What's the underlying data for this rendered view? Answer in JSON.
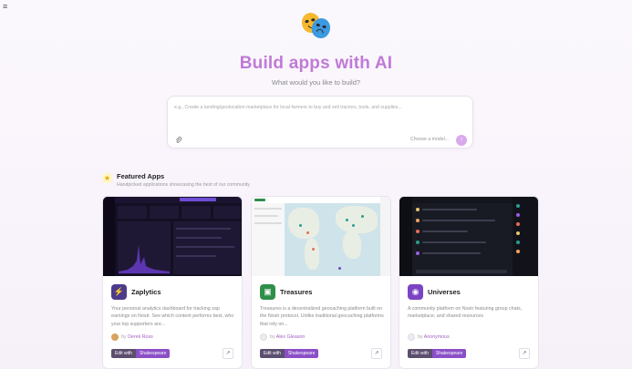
{
  "hero": {
    "title": "Build apps with AI",
    "subtitle": "What would you like to build?"
  },
  "prompt": {
    "placeholder": "e.g., Create a landing/geolocation marketplace for local farmers to buy and sell tractors, tools, and supplies...",
    "model_label": "Choose a model...",
    "attach_icon": "paperclip-icon",
    "send_icon": "arrow-up-icon"
  },
  "featured": {
    "title": "Featured Apps",
    "subtitle": "Handpicked applications showcasing the best of our community",
    "icon": "star-icon"
  },
  "apps": [
    {
      "name": "Zaplytics",
      "icon": "bolt-icon",
      "icon_color": "#4c3b8c",
      "description": "Your personal analytics dashboard for tracking zap earnings on Nostr. See which content performs best, who your top supporters are...",
      "by": "by",
      "author": "Derek Ross",
      "edit_label": "Edit with",
      "edit_tool": "Shakespeare"
    },
    {
      "name": "Treasures",
      "icon": "treasure-chest-icon",
      "icon_color": "#2f8f4a",
      "description": "Treasures is a decentralized geocaching platform built on the Nostr protocol. Unlike traditional geocaching platforms that rely on...",
      "by": "by",
      "author": "Alex Gleason",
      "edit_label": "Edit with",
      "edit_tool": "Shakespeare"
    },
    {
      "name": "Universes",
      "icon": "planet-icon",
      "icon_color": "#7a44c2",
      "description": "A community platform on Nostr featuring group chats, marketplace, and shared resources",
      "by": "by",
      "author": "Anonymous",
      "edit_label": "Edit with",
      "edit_tool": "Shakespeare"
    }
  ],
  "colors": {
    "accent": "#c07ad6",
    "button_purple": "#8b4fc7"
  }
}
